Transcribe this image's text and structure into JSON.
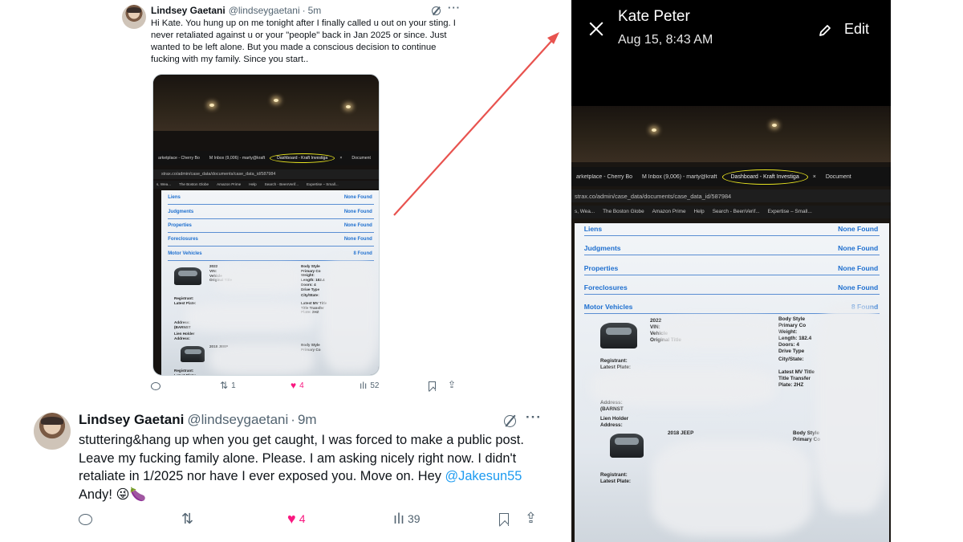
{
  "tweet1": {
    "name": "Lindsey Gaetani",
    "handle": "@lindseygaetani",
    "dot": "·",
    "time": "5m",
    "more": "···",
    "text": "Hi Kate. You hung up on me tonight after I finally called u out on your sting. I never retaliated against u or your \"people\" back in Jan 2025 or since. Just wanted to be left alone. But you made a conscious decision to continue fucking with my family. Since you start..",
    "actions": {
      "retweets": "1",
      "likes": "4",
      "views": "52"
    }
  },
  "tweet2": {
    "name": "Lindsey Gaetani",
    "handle": "@lindseygaetani",
    "dot": "·",
    "time": "9m",
    "more": "···",
    "text_before": "stuttering&hang up when you get caught, I was forced to make a public post. Leave my fucking family alone. Please. I am asking nicely right now. I didn't retaliate in 1/2025 nor have I ever exposed you. Move on. Hey ",
    "mention": "@Jakesun55",
    "text_after": " Andy! 😜🍆",
    "actions": {
      "retweets": "",
      "likes": "4",
      "views": "39"
    }
  },
  "viewer": {
    "title": "Kate Peter",
    "date": "Aug 15, 8:43 AM",
    "edit_label": "Edit"
  },
  "screen_photo": {
    "tabs": [
      "arketplace - Cherry Bo",
      "M  Inbox (9,006) - marty@kraft",
      "Dashboard - Kraft Investiga",
      "×",
      "Document"
    ],
    "url": "strax.co/admin/case_data/documents/case_data_id/587984",
    "bookmarks": [
      "s, Wea...",
      "The Boston Globe",
      "Amazon Prime",
      "Help",
      "Search - BeenVerif...",
      "Expertise – Small..."
    ],
    "rows": [
      {
        "label": "Liens",
        "value": "None Found"
      },
      {
        "label": "Judgments",
        "value": "None Found"
      },
      {
        "label": "Properties",
        "value": "None Found"
      },
      {
        "label": "Foreclosures",
        "value": "None Found"
      },
      {
        "label": "Motor Vehicles",
        "value": "8 Found"
      }
    ],
    "vehicle1": {
      "year": "2022",
      "fields": "VIN:\nVehicle\nOriginal Title",
      "style": "Body Style\nPrimary Co\nWeight:\nLength: 182.4\nDoors: 4\nDrive Type"
    },
    "registrant": "Registrant:\nLatest Plate:",
    "city_state": "City/State:",
    "title_info": "Latest MV Title\nTitle Transfer\nPlate: 2HZ",
    "address": "Address:\n(BARNST",
    "lien": "Lien Holder\nAddress:",
    "vehicle2": {
      "year": "2018 JEEP",
      "style": "Body Style\nPrimary Co"
    }
  },
  "colors": {
    "link": "#1d9bf0",
    "like": "#f91880",
    "muted": "#536471",
    "arrow": "#e8534f",
    "highlight_circle": "#e8e320"
  },
  "icons": {
    "reply": "reply-icon",
    "retweet": "retweet-icon",
    "like": "heart-icon",
    "views": "views-icon",
    "bookmark": "bookmark-icon",
    "share": "share-icon",
    "grok": "grok-icon",
    "close": "close-icon",
    "edit": "pencil-icon"
  }
}
